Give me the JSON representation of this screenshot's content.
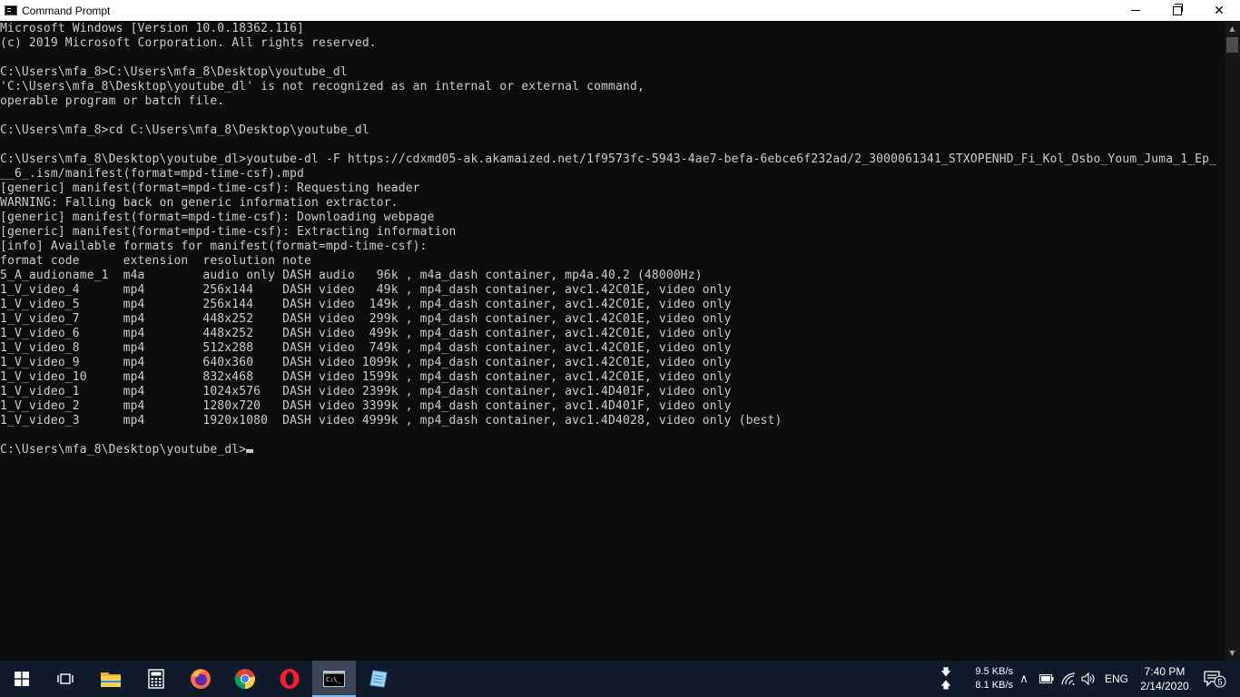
{
  "window": {
    "title": "Command Prompt",
    "icon": "cmd-icon",
    "controls": [
      "minimize-icon",
      "maximize-icon",
      "close-icon"
    ],
    "close_glyph": "✕"
  },
  "console": {
    "lines": [
      "Microsoft Windows [Version 10.0.18362.116]",
      "(c) 2019 Microsoft Corporation. All rights reserved.",
      "",
      "C:\\Users\\mfa_8>C:\\Users\\mfa_8\\Desktop\\youtube_dl",
      "'C:\\Users\\mfa_8\\Desktop\\youtube_dl' is not recognized as an internal or external command,",
      "operable program or batch file.",
      "",
      "C:\\Users\\mfa_8>cd C:\\Users\\mfa_8\\Desktop\\youtube_dl",
      "",
      "C:\\Users\\mfa_8\\Desktop\\youtube_dl>youtube-dl -F https://cdxmd05-ak.akamaized.net/1f9573fc-5943-4ae7-befa-6ebce6f232ad/2_3000061341_STXOPENHD_Fi_Kol_Osbo_Youm_Juma_1_Ep_",
      "__6_.ism/manifest(format=mpd-time-csf).mpd",
      "[generic] manifest(format=mpd-time-csf): Requesting header",
      "WARNING: Falling back on generic information extractor.",
      "[generic] manifest(format=mpd-time-csf): Downloading webpage",
      "[generic] manifest(format=mpd-time-csf): Extracting information",
      "[info] Available formats for manifest(format=mpd-time-csf):",
      "format code      extension  resolution note",
      "5_A_audioname_1  m4a        audio only DASH audio   96k , m4a_dash container, mp4a.40.2 (48000Hz)",
      "1_V_video_4      mp4        256x144    DASH video   49k , mp4_dash container, avc1.42C01E, video only",
      "1_V_video_5      mp4        256x144    DASH video  149k , mp4_dash container, avc1.42C01E, video only",
      "1_V_video_7      mp4        448x252    DASH video  299k , mp4_dash container, avc1.42C01E, video only",
      "1_V_video_6      mp4        448x252    DASH video  499k , mp4_dash container, avc1.42C01E, video only",
      "1_V_video_8      mp4        512x288    DASH video  749k , mp4_dash container, avc1.42C01E, video only",
      "1_V_video_9      mp4        640x360    DASH video 1099k , mp4_dash container, avc1.42C01E, video only",
      "1_V_video_10     mp4        832x468    DASH video 1599k , mp4_dash container, avc1.42C01E, video only",
      "1_V_video_1      mp4        1024x576   DASH video 2399k , mp4_dash container, avc1.4D401F, video only",
      "1_V_video_2      mp4        1280x720   DASH video 3399k , mp4_dash container, avc1.4D401F, video only",
      "1_V_video_3      mp4        1920x1080  DASH video 4999k , mp4_dash container, avc1.4D4028, video only (best)",
      ""
    ],
    "prompt": "C:\\Users\\mfa_8\\Desktop\\youtube_dl>",
    "text_color": "#cccccc",
    "background": "#0c0c0c"
  },
  "scrollbar": {
    "up_glyph": "▲",
    "down_glyph": "▼"
  },
  "taskbar": {
    "background": "#0f1a2b",
    "apps": [
      {
        "name": "start",
        "icon": "windows-logo-icon"
      },
      {
        "name": "task-view",
        "icon": "task-view-icon"
      },
      {
        "name": "file-explorer",
        "icon": "folder-icon"
      },
      {
        "name": "calculator",
        "icon": "calculator-icon"
      },
      {
        "name": "firefox",
        "icon": "firefox-icon"
      },
      {
        "name": "chrome",
        "icon": "chrome-icon"
      },
      {
        "name": "opera",
        "icon": "opera-icon"
      },
      {
        "name": "command-prompt",
        "icon": "cmd-icon",
        "active": true
      },
      {
        "name": "notepad",
        "icon": "notepad-icon"
      }
    ],
    "tray": {
      "download_arrow": "🡇",
      "upload_arrow": "🡅",
      "download_speed": "9.5 KB/s",
      "upload_speed": "8.1 KB/s",
      "chevron": "∧",
      "language": "ENG",
      "time": "7:40 PM",
      "date": "2/14/2020",
      "notification_count": "5"
    }
  }
}
